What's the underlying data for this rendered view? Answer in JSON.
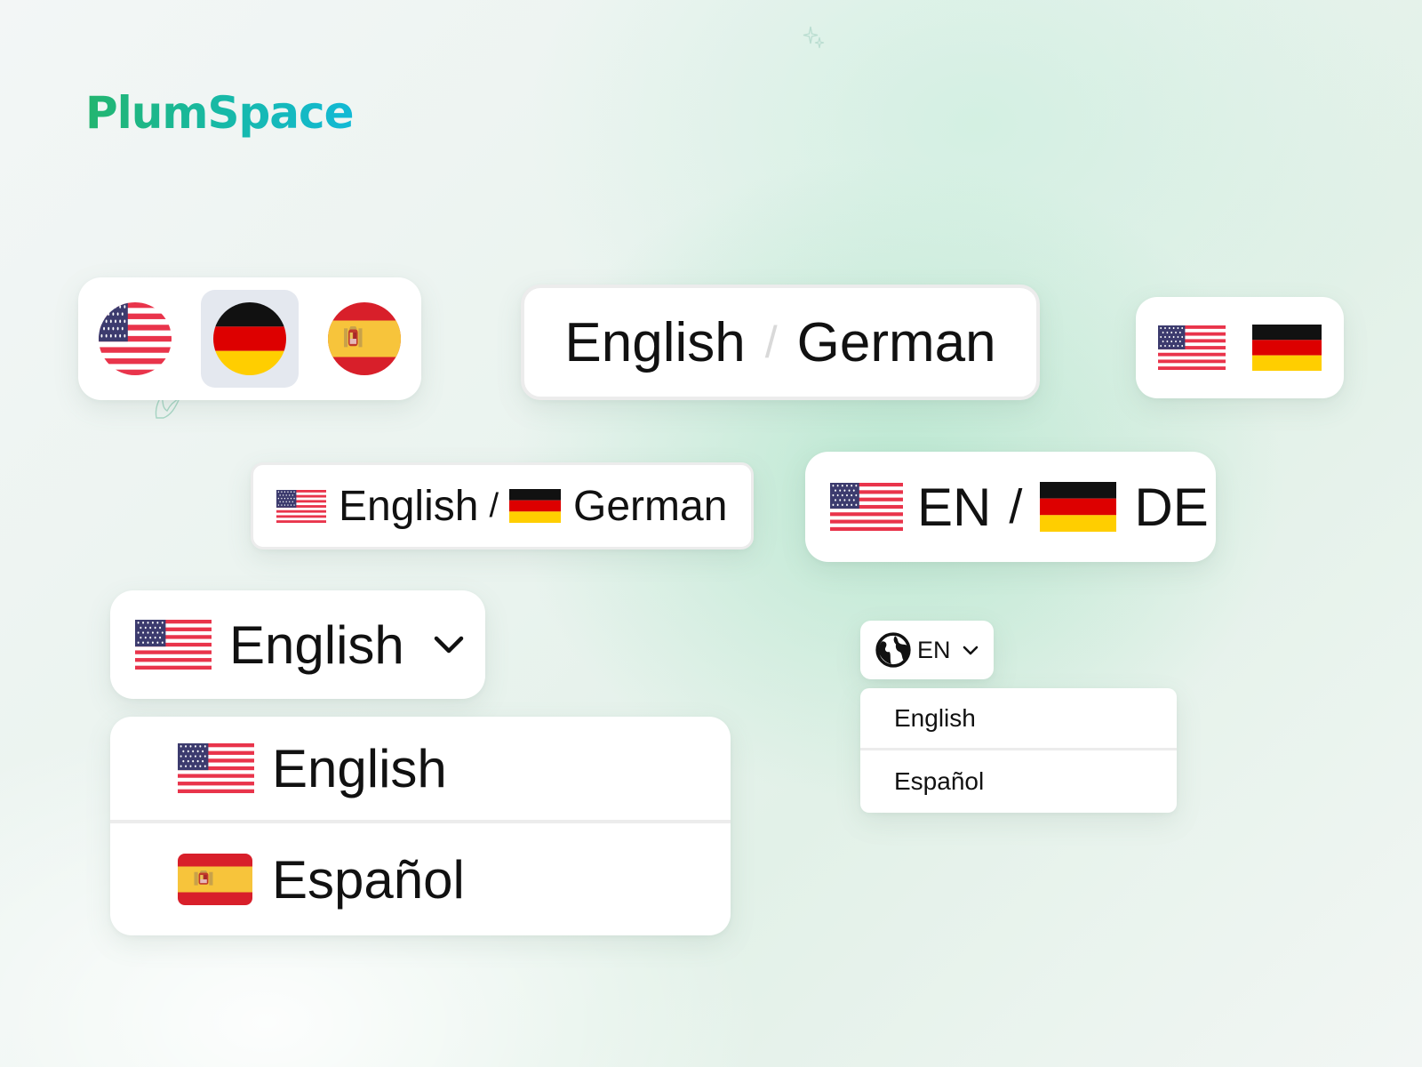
{
  "brand": {
    "name": "PlumSpace"
  },
  "colors": {
    "brand_green": "#23b56f",
    "brand_cyan": "#12b9d6",
    "flag_red": "#e9344b",
    "flag_blue": "#3c3b6e",
    "de_black": "#111111",
    "de_red": "#dd0000",
    "de_gold": "#ffce00",
    "es_red": "#d81f2a",
    "es_yellow": "#f7c43b"
  },
  "icons": [
    "flag-us-icon",
    "flag-de-icon",
    "flag-es-icon",
    "globe-icon",
    "chevron-down-icon",
    "sparkle-icon",
    "leaf-icon"
  ],
  "round_switcher": {
    "options": [
      "flag-us",
      "flag-de",
      "flag-es"
    ],
    "selected": "flag-de"
  },
  "text_toggle": {
    "left": "English",
    "separator": "/",
    "right": "German"
  },
  "flag_toggle": {
    "options": [
      "flag-us",
      "flag-de"
    ]
  },
  "flag_text_toggle": {
    "left": "English",
    "separator": "/",
    "right": "German"
  },
  "code_toggle": {
    "left": "EN",
    "separator": "/",
    "right": "DE"
  },
  "large_dropdown": {
    "selected": "English",
    "options": [
      {
        "flag": "flag-us",
        "label": "English"
      },
      {
        "flag": "flag-es",
        "label": "Español"
      }
    ]
  },
  "small_dropdown": {
    "selected": "EN",
    "options": [
      {
        "label": "English"
      },
      {
        "label": "Español"
      }
    ]
  }
}
